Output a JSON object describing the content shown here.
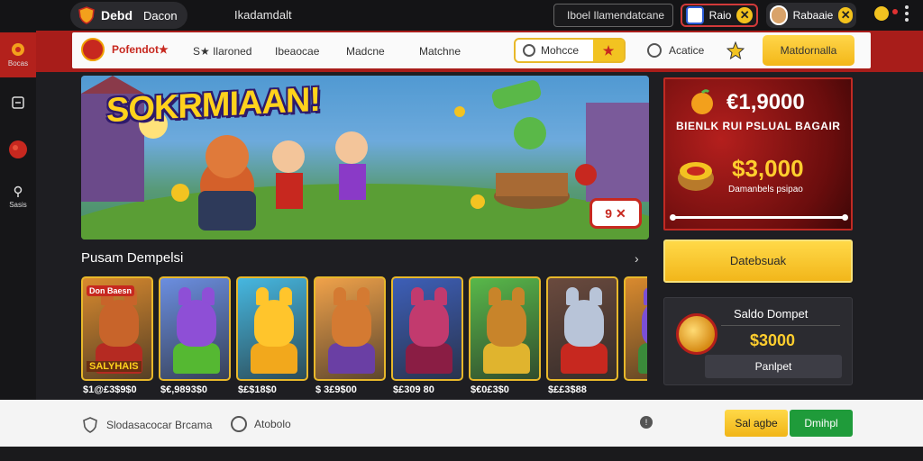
{
  "topbar": {
    "logo_text": "Debd",
    "logo_text2": "Dacon",
    "title": "Ikadamdalt",
    "search_label": "Iboel Ilamendatcane",
    "user1_label": "Raio",
    "user2_label": "Rabaaie"
  },
  "sidebar": {
    "items": [
      {
        "label": "Bocas"
      },
      {
        "label": ""
      },
      {
        "label": ""
      },
      {
        "label": "Sasis"
      }
    ]
  },
  "nav": {
    "brand": "Pofendot★",
    "items": [
      "S★ Ilaroned",
      "Ibeaocae",
      "Madcne",
      "Matchne"
    ],
    "tab_label": "Mohcce",
    "tab_icon": "★",
    "item5": "Acatice",
    "cta": "Matdornalla"
  },
  "banner": {
    "title": "SOKRMIAAN!",
    "close_label": "9 ✕"
  },
  "promo": {
    "amount1": "€1,9000",
    "subtitle": "BIENLK RUI PSLUAL BAGAIR",
    "amount2": "$3,000",
    "caption": "Damanbels psipao",
    "button": "Datebsuak"
  },
  "wallet": {
    "title": "Saldo Dompet",
    "amount": "$3000",
    "button": "Panlpet"
  },
  "section": {
    "title": "Pusam Dempelsi",
    "arrow": "›"
  },
  "cards": [
    {
      "price": "$1@£3$9$0",
      "label": "Don Baesn",
      "sublabel": "SALYHAIS",
      "bg": "#d98a2e",
      "char": "#c8642a",
      "body": "#b52a22"
    },
    {
      "price": "$€,9893$0",
      "label": "",
      "sublabel": "",
      "bg": "#6b8ee0",
      "char": "#8e4fd6",
      "body": "#55b832"
    },
    {
      "price": "$£$18$0",
      "label": "",
      "sublabel": "",
      "bg": "#46b7e0",
      "char": "#ffc52c",
      "body": "#f2a81c"
    },
    {
      "price": "$ 3£9$00",
      "label": "",
      "sublabel": "",
      "bg": "#f0a24a",
      "char": "#d47a32",
      "body": "#6a3fa4"
    },
    {
      "price": "$£309 80",
      "label": "",
      "sublabel": "",
      "bg": "#3d5fb8",
      "char": "#c23a6e",
      "body": "#8a1d44"
    },
    {
      "price": "$€0£3$0",
      "label": "",
      "sublabel": "",
      "bg": "#58b84a",
      "char": "#c8842a",
      "body": "#e0b42e"
    },
    {
      "price": "$££3$88",
      "label": "",
      "sublabel": "",
      "bg": "#6a4a3e",
      "char": "#b8c4d8",
      "body": "#c7281f"
    },
    {
      "price": "",
      "label": "",
      "sublabel": "",
      "bg": "#d98a2e",
      "char": "#7a4fd6",
      "body": "#3a8a3a"
    }
  ],
  "bottom": {
    "item1": "Slodasacocar Brcama",
    "item2": "Atobolo",
    "info_icon": "!",
    "btn1": "Sal agbe",
    "btn2": "Dmihpl"
  },
  "colors": {
    "accent_red": "#a81d1a",
    "accent_yellow": "#f2c321",
    "accent_green": "#1f9b3a"
  }
}
